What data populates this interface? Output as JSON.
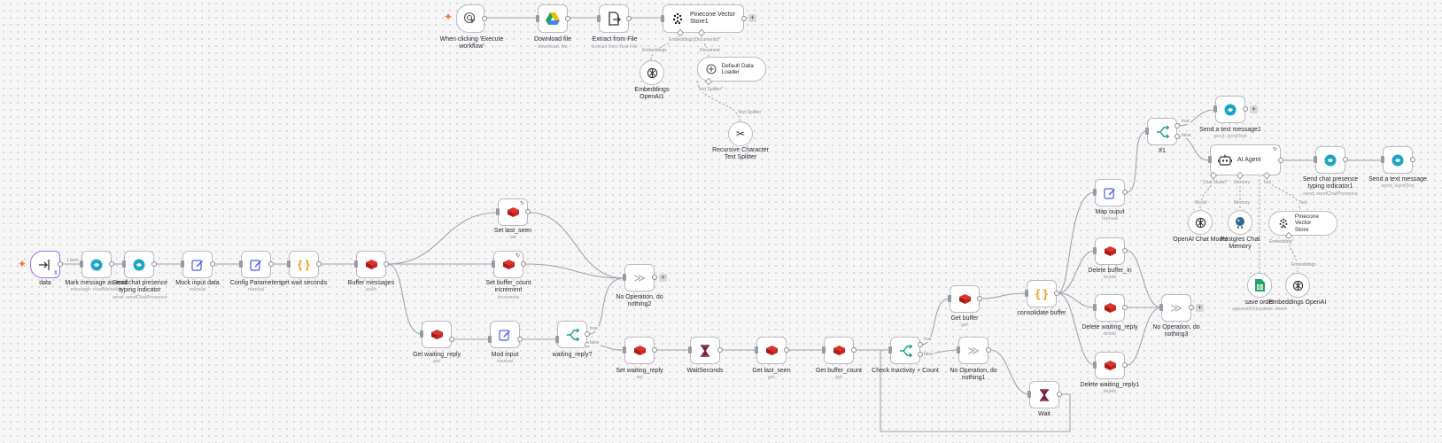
{
  "canvas": {
    "accent": "#ff6d2e",
    "selection": "#9b6bff"
  },
  "nodes": {
    "trigger_manual": {
      "label": "When clicking 'Execute\nworkflow'",
      "sub": ""
    },
    "download_file": {
      "label": "Download file",
      "sub": "download: file"
    },
    "extract_file": {
      "label": "Extract from File",
      "sub": "Extract from Text File"
    },
    "pinecone_store1": {
      "label": "Pinecone Vector\nStore1",
      "sub": ""
    },
    "embeddings_openai_top": {
      "label": "Embeddings\nOpenAI1",
      "sub": ""
    },
    "default_data_loader": {
      "label": "Default Data Loader",
      "sub": ""
    },
    "recursive_splitter": {
      "label": "Recursive Character\nText Splitter",
      "sub": ""
    },
    "data": {
      "label": "data",
      "sub": ""
    },
    "mark_read": {
      "label": "Mark message as read",
      "sub": "message: readMessage"
    },
    "send_presence": {
      "label": "Send chat presence\ntyping indicator",
      "sub": "send: sendChatPresence"
    },
    "mock_input": {
      "label": "Mock input data",
      "sub": "manual"
    },
    "config_params": {
      "label": "Config Parameters",
      "sub": "manual"
    },
    "get_wait_seconds": {
      "label": "get wait seconds",
      "sub": ""
    },
    "buffer_messages": {
      "label": "Buffer messages",
      "sub": "push"
    },
    "set_last_seen": {
      "label": "Set last_seen",
      "sub": "set"
    },
    "set_buffer_count": {
      "label": "Set buffer_count\nincrement",
      "sub": "incremeta"
    },
    "noop2": {
      "label": "No Operation, do\nnothing2",
      "sub": ""
    },
    "get_waiting_reply": {
      "label": "Get waiting_reply",
      "sub": "get"
    },
    "mod_input": {
      "label": "Mod input",
      "sub": "manual"
    },
    "waiting_reply_if": {
      "label": "waiting_reply?",
      "sub": ""
    },
    "set_waiting_reply": {
      "label": "Set waiting_reply",
      "sub": "set"
    },
    "wait_seconds": {
      "label": "WaitSeconds",
      "sub": ""
    },
    "get_last_seen": {
      "label": "Get last_seen",
      "sub": "get"
    },
    "get_buffer_count": {
      "label": "Get buffer_count",
      "sub": "get"
    },
    "check_inactivity": {
      "label": "Check Inactivity + Count",
      "sub": ""
    },
    "noop1": {
      "label": "No Operation, do\nnothing1",
      "sub": ""
    },
    "get_buffer": {
      "label": "Get buffer",
      "sub": "get"
    },
    "consolidate_buffer": {
      "label": "consolidate buffer",
      "sub": ""
    },
    "wait": {
      "label": "Wait",
      "sub": ""
    },
    "map_output": {
      "label": "Map ouput",
      "sub": "manual"
    },
    "delete_buffer_in": {
      "label": "Delete buffer_in",
      "sub": "delete"
    },
    "delete_waiting_reply": {
      "label": "Delete waiting_reply",
      "sub": "delete"
    },
    "delete_waiting_reply1": {
      "label": "Delete waiting_reply1",
      "sub": "delete"
    },
    "noop3": {
      "label": "No Operation, do\nnothing3",
      "sub": ""
    },
    "if1": {
      "label": "If1",
      "sub": ""
    },
    "send_text1": {
      "label": "Send a text message1",
      "sub": "send: sendText"
    },
    "ai_agent": {
      "label": "AI Agent",
      "sub": ""
    },
    "send_presence1": {
      "label": "Send chat presence\ntyping indicator1",
      "sub": "send: sendChatPresence"
    },
    "send_text": {
      "label": "Send a text message",
      "sub": "send: sendText"
    },
    "openai_chat": {
      "label": "OpenAI Chat Model",
      "sub": ""
    },
    "postgres_memory": {
      "label": "Postgres Chat\nMemory",
      "sub": ""
    },
    "pinecone_store": {
      "label": "Pinecone Vector\nStore",
      "sub": ""
    },
    "save_order": {
      "label": "save order",
      "sub": "append(Or)update: sheet"
    },
    "embeddings_openai": {
      "label": "Embeddings OpenAI",
      "sub": ""
    }
  },
  "edge_labels": {
    "data_items": "1 item",
    "embeddings": "Embeddings",
    "document": "Document",
    "embeddings_top": "Embeddings(Documents)*",
    "text_splitter": "Text Splitter*",
    "text_splitter2": "Text Splitter",
    "true": "true",
    "false": "false",
    "chat_model": "Chat Model*",
    "model": "Model",
    "memory": "Memory",
    "memory2": "Memory",
    "tool": "Tool",
    "tool2": "Tool",
    "embedding": "Embedding*",
    "embeddings2": "Embeddings"
  }
}
